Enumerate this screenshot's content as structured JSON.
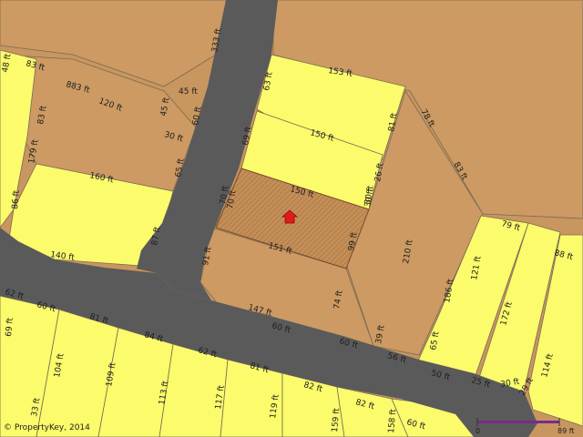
{
  "map": {
    "colors": {
      "background": "#c8965f",
      "parcel_tan": "#cc9a62",
      "parcel_yellow": "#fbfb6b",
      "road": "#5a5a5a",
      "lines": "#7a6a55",
      "selected": "#b98550",
      "marker": "#e01a1a",
      "scale_bar": "#7a2a8a"
    },
    "selected_parcel": {
      "marker": "home-icon",
      "dimensions": [
        "150 ft",
        "151 ft",
        "70 ft",
        "30 ft",
        "99 ft"
      ]
    },
    "copyright": "© PropertyKey, 2014",
    "scale": {
      "start": "0",
      "end": "89 ft"
    },
    "labels": [
      "333 ft",
      "83 ft",
      "883 ft",
      "120 ft",
      "48 ft",
      "45 ft",
      "45 ft",
      "30 ft",
      "60 ft",
      "63 ft",
      "153 ft",
      "150 ft",
      "81 ft",
      "69 ft",
      "78 ft",
      "83 ft",
      "179 ft",
      "86 ft",
      "160 ft",
      "65 ft",
      "26 ft",
      "83 ft",
      "30 ft",
      "87 ft",
      "140 ft",
      "70 ft",
      "210 ft",
      "79 ft",
      "88 ft",
      "91 ft",
      "121 ft",
      "186 ft",
      "172 ft",
      "147 ft",
      "74 ft",
      "62 ft",
      "60 ft",
      "81 ft",
      "84 ft",
      "60 ft",
      "39 ft",
      "65 ft",
      "114 ft",
      "69 ft",
      "104 ft",
      "109 ft",
      "113 ft",
      "117 ft",
      "119 ft",
      "159 ft",
      "158 ft",
      "62 ft",
      "81 ft",
      "82 ft",
      "82 ft",
      "60 ft",
      "56 ft",
      "50 ft",
      "25 ft",
      "30 ft",
      "29 ft",
      "33 ft",
      "60 ft"
    ]
  }
}
